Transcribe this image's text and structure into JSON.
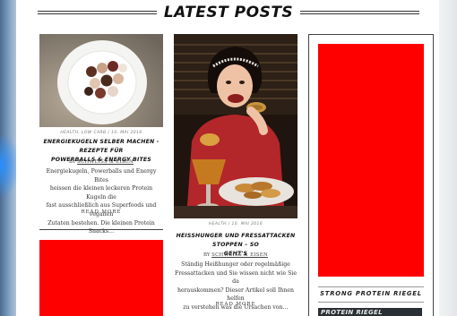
{
  "section": {
    "title": "LATEST POSTS"
  },
  "posts": [
    {
      "meta": "HEALTH, LOW CARB / 10. MAI 2016",
      "title_line1": "ENERGIEKUGELN SELBER MACHEN - REZEPTE FÜR",
      "title_line2": "POWERBALLS & ENERGY BITES",
      "by": "BY",
      "author": "SCHWEISS & EISEN",
      "excerpt": [
        "Energiekugeln, Powerballs und Energy Bites",
        "heissen die kleinen leckeren Protein Kugeln die",
        "fast ausschließlich aus Superfoods und veganen",
        "Zutaten bestehen. Die kleinen Protein Snacks…"
      ],
      "read_more": "READ MORE"
    },
    {
      "meta": "HEALTH / 10. MAI 2016",
      "title_line1": "HEISSHUNGER UND FRESSATTACKEN STOPPEN – SO",
      "title_line2": "GEHT'S",
      "by": "BY",
      "author": "SCHWEISS & EISEN",
      "excerpt": [
        "Ständig Heißhunger oder regelmäßige",
        "Fressattacken und Sie wissen nicht wie Sie da",
        "herauskommen? Dieser Artikel soll Ihnen helfen",
        "zu verstehen was die Ursachen von…"
      ],
      "read_more": "READ MORE"
    }
  ],
  "sidebar": {
    "widget_title": "STRONG PROTEIN RIEGEL",
    "promo_text": "PROTEIN RIEGEL"
  },
  "colors": {
    "ad_red": "#ff0000",
    "heading": "#111111",
    "border": "#444444"
  },
  "icons": {
    "food_plate": "energy-balls-plate-image",
    "person": "woman-eating-image"
  }
}
